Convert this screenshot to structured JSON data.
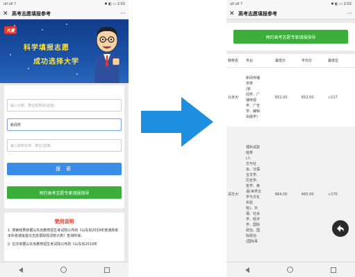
{
  "left_phone": {
    "status_time": "2:02",
    "status_signal": "ull ull ?",
    "status_icons": "✱ ◧ ▭",
    "title": "高考志愿填报参考",
    "close_label": "✕",
    "more_label": "···",
    "banner": {
      "logo": "大夏",
      "slogan_line1": "科学填报志愿",
      "slogan_line2": "成功选择大学"
    },
    "form": {
      "field1_placeholder": "输入分数、排位或类别(选填)",
      "field2_value": "新闻学",
      "field3_placeholder": "输入院校名称、排位(选填)",
      "search_label": "搜 索",
      "consult_label": "预约高考志愿专家填报指导"
    },
    "usage": {
      "title": "使用说明",
      "line1": "1. 搜索结果依据山东省教育招生考试院公布的《山东省2019年普通高考本科普通批首次志愿录取情况统计表》查询所得。",
      "line2": "2. 位次依据山东省教育招生考试院公布的《山东省2019年"
    }
  },
  "right_phone": {
    "status_time": "2:02",
    "status_signal": "ull ull ?",
    "status_icons": "✱ ◧ ▭",
    "title": "高考志愿填报参考",
    "close_label": "✕",
    "more_label": "···",
    "consult_label": "预约高考志愿专家填报指导",
    "table": {
      "headers": [
        "院校名",
        "专业",
        "最低分",
        "平均分",
        "最低位"
      ],
      "rows": [
        {
          "school": "北京大学",
          "major_lines": [
            "新闻传播",
            "学类",
            "(新",
            "闻学、广",
            "播电视",
            "学、广告",
            "学、编辑",
            "出版学)"
          ],
          "min_score": "651.00",
          "avg_score": "652.00",
          "min_rank": "≈117"
        },
        {
          "school": "清华大学",
          "major_lines": [
            "理科试验",
            "班类",
            "(人",
            "文与社",
            "会、汉语",
            "言文学、",
            "历史学、",
            "哲学、英",
            "语(世界文",
            "学与文化",
            "实验",
            "班)、日",
            "语、社会",
            "学、经济",
            "学、国际",
            "政治、国",
            "际政治",
            "(国际事"
          ],
          "min_score": "664.00",
          "avg_score": "665.00",
          "min_rank": "≈170"
        }
      ]
    }
  },
  "colors": {
    "accent_blue": "#3b8ee8",
    "accent_green": "#3cae3c",
    "arrow_blue": "#1e8fe0",
    "usage_red": "#e03a2a"
  }
}
